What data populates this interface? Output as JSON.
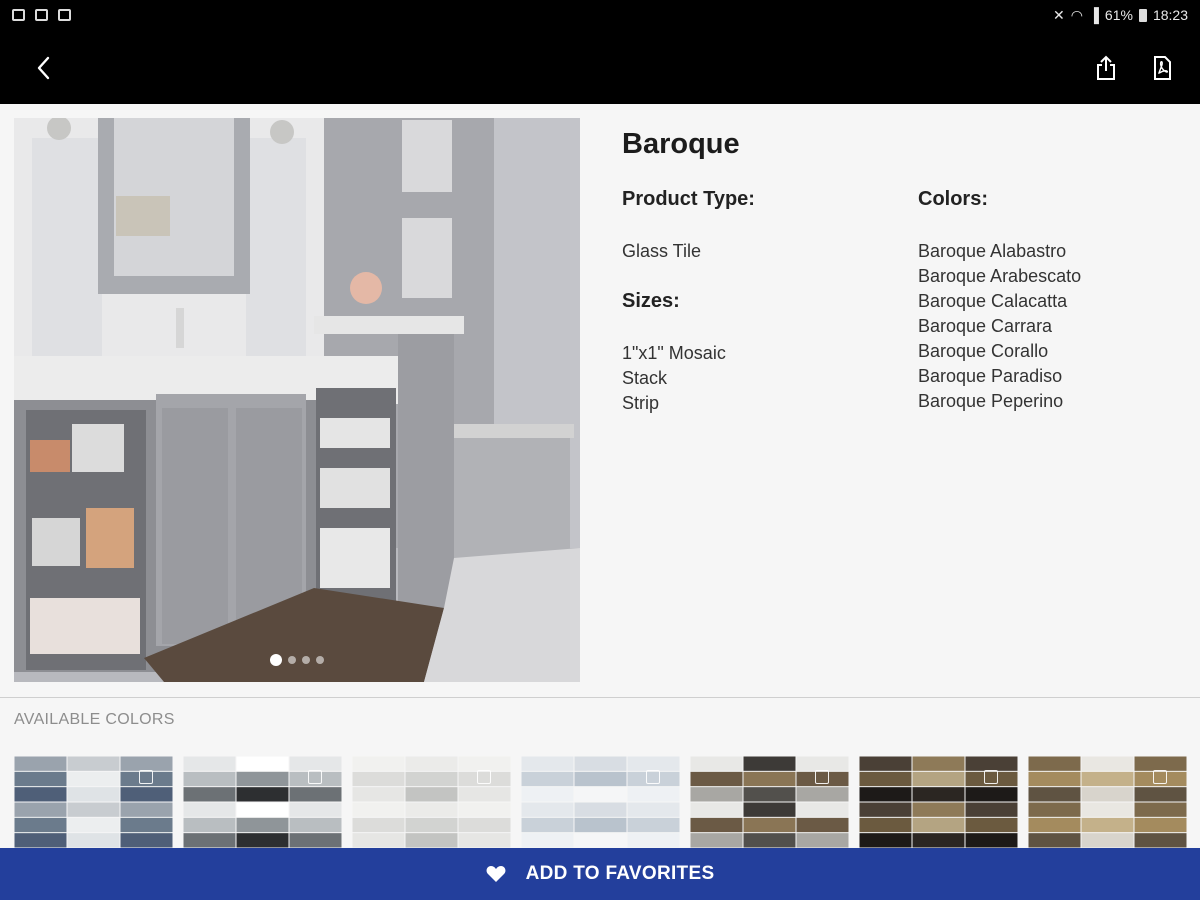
{
  "status_bar": {
    "right_text": "61%",
    "time": "18:23"
  },
  "app_bar": {
    "back_icon": "chevron-left-icon",
    "share_icon": "share-icon",
    "pdf_icon": "pdf-icon"
  },
  "hero": {
    "active_slide": 1,
    "slide_count": 4
  },
  "product": {
    "title": "Baroque",
    "type_label": "Product Type:",
    "type_value": "Glass Tile",
    "sizes_label": "Sizes:",
    "sizes": [
      "1\"x1\" Mosaic",
      "Stack",
      "Strip"
    ],
    "colors_label": "Colors:",
    "colors": [
      "Baroque Alabastro",
      "Baroque Arabescato",
      "Baroque Calacatta",
      "Baroque Carrara",
      "Baroque Corallo",
      "Baroque Paradiso",
      "Baroque Peperino"
    ]
  },
  "available_colors": {
    "title": "AVAILABLE COLORS",
    "swatches": [
      {
        "palette": [
          "#9aa3ad",
          "#dfe3e6",
          "#6b7b8c",
          "#c8ccd0",
          "#4f5f78",
          "#eceeef"
        ]
      },
      {
        "palette": [
          "#8f9599",
          "#e5e7e8",
          "#2d2f31",
          "#b9bec1",
          "#ffffff",
          "#6c7175"
        ]
      },
      {
        "palette": [
          "#e6e6e4",
          "#d2d3d1",
          "#f1f1ef",
          "#c3c4c2",
          "#dcdcda",
          "#ebebe9"
        ]
      },
      {
        "palette": [
          "#d8dde3",
          "#eef1f4",
          "#b9c3cd",
          "#e4e8ec",
          "#f5f6f7",
          "#c9d1d9"
        ]
      },
      {
        "palette": [
          "#6b5a45",
          "#3d3a37",
          "#a8a7a3",
          "#8a7555",
          "#e8e8e6",
          "#52504c"
        ]
      },
      {
        "palette": [
          "#2b2622",
          "#6b5a3f",
          "#8e7a58",
          "#1d1a18",
          "#b4a482",
          "#4a4036"
        ]
      },
      {
        "palette": [
          "#7d6a4c",
          "#d8d4cc",
          "#a48b5e",
          "#e9e7e2",
          "#5f5342",
          "#c4b18a"
        ]
      }
    ]
  },
  "cta": {
    "label": "ADD TO FAVORITES",
    "icon": "heart-icon"
  },
  "colors": {
    "cta_blue": "#233f9c",
    "bar_black": "#000000"
  }
}
